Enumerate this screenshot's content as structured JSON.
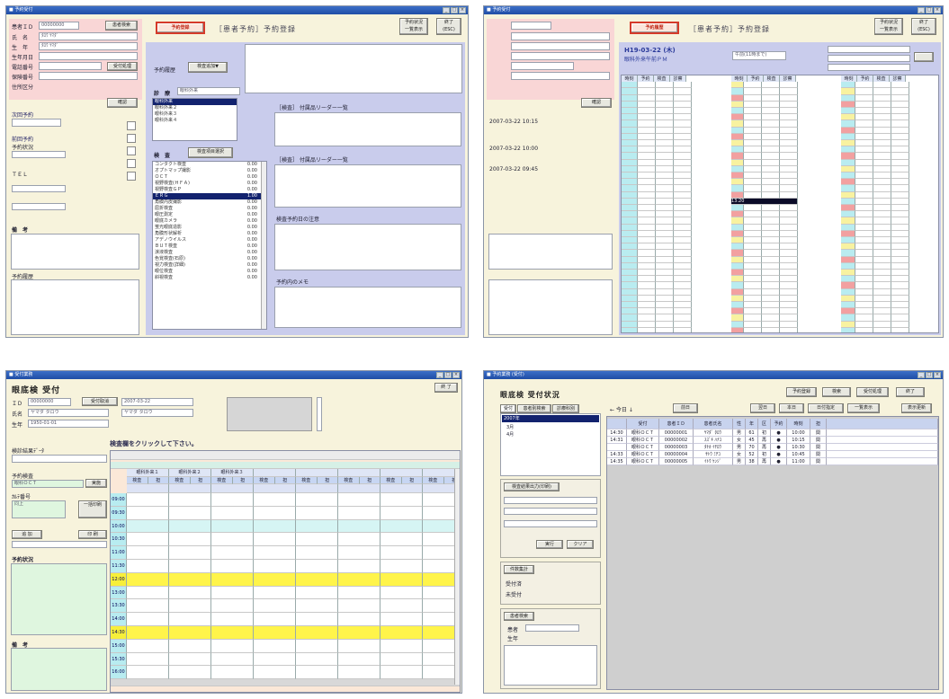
{
  "shots": [
    {
      "titlebar": "■ 予約受付",
      "window_controls": [
        "_",
        "□",
        "×"
      ],
      "form_labels": [
        "患者ＩＤ",
        "氏　名",
        "生　年",
        "生年月日",
        "電話番号",
        "保険番号",
        "住所区分"
      ],
      "form_values": [
        "00000000",
        "ﾀﾛｳ ﾔﾏﾀﾞ",
        "ﾀﾛｳ ﾔﾏﾀﾞ"
      ],
      "search_button": "患者検索",
      "search_button_2": "受付処理",
      "small_button": "確認",
      "mode_button": "予約登録",
      "heading_sub": "［患者予約］",
      "heading_main": "予約登録",
      "top_buttons": [
        "予約状況\n一覧表示",
        "終了\n(ESC)"
      ],
      "left_section_labels": [
        "次回予約",
        "前回予約",
        "予約状況",
        "ＴＥＬ"
      ],
      "left_date_values": [
        "2007-03-22",
        "2007-03-29"
      ],
      "notes_label": "備　考",
      "history_label": "予約履歴",
      "memo_label": "予約履歴",
      "memo_button": "検査追加▼",
      "dept_label": "診　療",
      "dept_value": "眼科外来",
      "dept_items": [
        "眼科外来",
        "眼科外来２",
        "眼科外来３",
        "眼科外来４"
      ],
      "exam_label": "検　査",
      "exam_button": "検査項目選択",
      "exam_items": [
        "コンタクト検査",
        "オプトマップ撮影",
        "ＯＣＴ",
        "視野検査(ＨＦＡ)",
        "視野検査ＧＰ",
        "ＥＲＧ",
        "角膜内皮撮影",
        "屈折検査",
        "眼圧測定",
        "眼底カメラ",
        "蛍光眼底造影",
        "角膜形状解析",
        "アデノウイルス",
        "ＢＵＴ検査",
        "涙液検査",
        "色覚検査(石原)",
        "視力検査(詳細)",
        "眼位検査",
        "斜視検査"
      ],
      "exam_codes": [
        "0.00",
        "0.00",
        "0.00",
        "0.00",
        "0.00",
        "1.00",
        "0.00",
        "0.00",
        "0.00",
        "0.00",
        "0.00",
        "0.00",
        "0.00",
        "0.00",
        "0.00",
        "0.00",
        "0.00",
        "0.00",
        "0.00"
      ],
      "selected_exam_index": 5,
      "right_sections": [
        "［検査］ 付属品リーダー一覧",
        "［検査］ 付属品リーダー一覧",
        "検査予約日の注意",
        "予約内のメモ"
      ]
    },
    {
      "titlebar": "■ 予約受付",
      "heading_sub": "［患者予約］",
      "heading_main": "予約登録",
      "mode_button": "予約履歴",
      "date_line": "H19-03-22 (木)",
      "dept_line": "眼科外来午前ＰＭ",
      "selector_value": "午前(11時まで)",
      "small_side_button": "確認",
      "top_buttons": [
        "予約状況\n一覧表示",
        "終了\n(ESC)"
      ],
      "column_headers": [
        "時刻",
        "予約",
        "検査",
        "診察"
      ],
      "selected_row": "13:20",
      "left_dates": [
        "2007-03-22  10:15",
        "2007-03-22  10:00",
        "2007-03-22  09:45"
      ]
    },
    {
      "titlebar": "■ 受付業務",
      "window_controls": [
        "_",
        "□",
        "×"
      ],
      "heading": "眼底検 受付",
      "close_button": "終 了",
      "field_labels": [
        "ＩＤ",
        "氏名",
        "生年"
      ],
      "field_values": [
        "00000000",
        "ヤマダ タロウ",
        "1950-01-01"
      ],
      "search_button": "受付取消",
      "date_value": "2007-03-22",
      "kana_value": "ヤマダ タロウ",
      "left_labels": [
        "検診結果ﾃﾞｰﾀ",
        "予約検査",
        "ｶﾙﾃ番号",
        "ﾃﾞｰﾀ作成"
      ],
      "left_values": [
        "眼科ＯＣＴ",
        "同上"
      ],
      "left_buttons": [
        "実施",
        "一括印刷",
        "追 加",
        "印 刷"
      ],
      "checklist_label": "予約状況",
      "notes_label": "備　考",
      "instruction": "検査欄をクリックして下さい。",
      "row_times": [
        "09:00",
        "09:30",
        "10:00",
        "10:30",
        "11:00",
        "11:30",
        "12:00",
        "13:00",
        "13:30",
        "14:00",
        "14:30",
        "15:00",
        "15:30",
        "16:00"
      ],
      "col_groups": [
        "眼科外来１",
        "眼科外来２",
        "眼科外来３",
        "眼科ＯＣＴ",
        "眼科視野",
        "眼科ＯＣＴ",
        "眼科視野",
        "眼科ＥＲＧ"
      ],
      "sub_headers": [
        "検査",
        "担"
      ]
    },
    {
      "titlebar": "■ 予約業務 (受付)",
      "window_controls": [
        "_",
        "□",
        "×"
      ],
      "heading": "眼底検 受付状況",
      "tabs": [
        "受付",
        "患者別検索",
        "診療科別"
      ],
      "tree_items": [
        "2007年",
        "3月",
        "4月"
      ],
      "today_label": "← 今日 ↓",
      "date_buttons": [
        "前日",
        "翌日",
        "本日",
        "日付指定",
        "一覧表示"
      ],
      "top_buttons": [
        "予約登録",
        "検索",
        "受付処理",
        "終了"
      ],
      "right_button": "表示更新",
      "search_box_title": "検査結果出力(印刷)",
      "search_buttons": [
        "実行",
        "クリア"
      ],
      "counts_title": "件数集計",
      "counts_labels": [
        "受付済",
        "未受付"
      ],
      "filter_title": "患者検索",
      "filter_labels": [
        "患者",
        "生年"
      ],
      "table_headers": [
        "受付",
        "患者ＩＤ",
        "患者氏名",
        "性",
        "年",
        "区",
        "予約",
        "時刻",
        "担"
      ],
      "rows": [
        [
          "14:30",
          "眼科ＯＣＴ",
          "00000001",
          "ﾔﾏﾀﾞ ﾀﾛｳ",
          "男",
          "61",
          "初",
          "●",
          "10:00",
          "関"
        ],
        [
          "14:31",
          "眼科ＯＣＴ",
          "00000002",
          "ｽｽﾞｷ ﾊﾅｺ",
          "女",
          "45",
          "再",
          "●",
          "10:15",
          "関"
        ],
        [
          "",
          "眼科ＯＣＴ",
          "00000003",
          "ﾀﾅｶ ｲﾁﾛｳ",
          "男",
          "70",
          "再",
          "●",
          "10:30",
          "関"
        ],
        [
          "14:33",
          "眼科ＯＣＴ",
          "00000004",
          "ｻﾄｳ ﾐﾁｺ",
          "女",
          "52",
          "初",
          "●",
          "10:45",
          "関"
        ],
        [
          "14:35",
          "眼科ＯＣＴ",
          "00000005",
          "ｲﾄｳ ｹﾝｼﾞ",
          "男",
          "38",
          "再",
          "●",
          "11:00",
          "関"
        ]
      ]
    }
  ]
}
